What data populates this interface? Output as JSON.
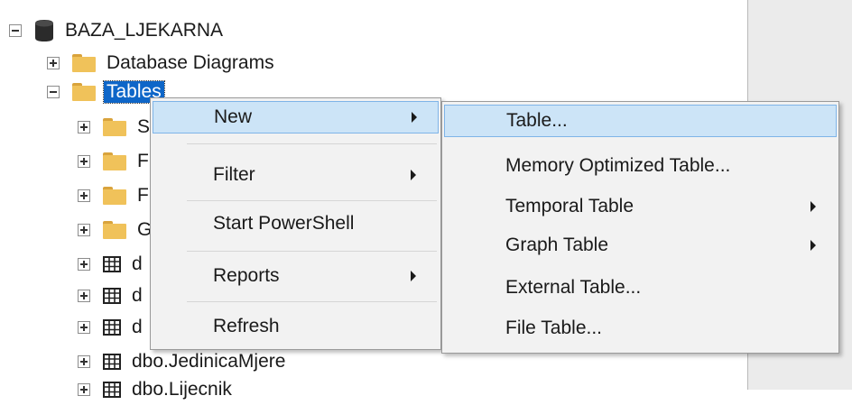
{
  "tree": {
    "database": "BAZA_LJEKARNA",
    "database_diagrams": "Database Diagrams",
    "tables": "Tables",
    "children": [
      {
        "icon": "folder-icon",
        "label": "S"
      },
      {
        "icon": "folder-icon",
        "label": "F"
      },
      {
        "icon": "folder-icon",
        "label": "F"
      },
      {
        "icon": "folder-icon",
        "label": "G"
      },
      {
        "icon": "table-icon",
        "label": "d"
      },
      {
        "icon": "table-icon",
        "label": "d"
      },
      {
        "icon": "table-icon",
        "label": "d"
      },
      {
        "icon": "table-icon",
        "label": "dbo.JedinicaMjere"
      },
      {
        "icon": "table-icon",
        "label": "dbo.Lijecnik"
      }
    ]
  },
  "context_menu": {
    "items": [
      {
        "label": "New",
        "submenu": true
      },
      {
        "label": "Filter",
        "submenu": true
      },
      {
        "label": "Start PowerShell",
        "submenu": false
      },
      {
        "label": "Reports",
        "submenu": true
      },
      {
        "label": "Refresh",
        "submenu": false
      }
    ]
  },
  "new_submenu": {
    "items": [
      {
        "label": "Table...",
        "submenu": false
      },
      {
        "label": "Memory Optimized Table...",
        "submenu": false
      },
      {
        "label": "Temporal Table",
        "submenu": true
      },
      {
        "label": "Graph Table",
        "submenu": true
      },
      {
        "label": "External Table...",
        "submenu": false
      },
      {
        "label": "File Table...",
        "submenu": false
      }
    ]
  },
  "colors": {
    "selection": "#0e66c8",
    "menu_highlight": "#cce4f7",
    "menu_highlight_border": "#7fb4e8",
    "folder": "#f0c25a",
    "menu_bg": "#f2f2f2"
  }
}
